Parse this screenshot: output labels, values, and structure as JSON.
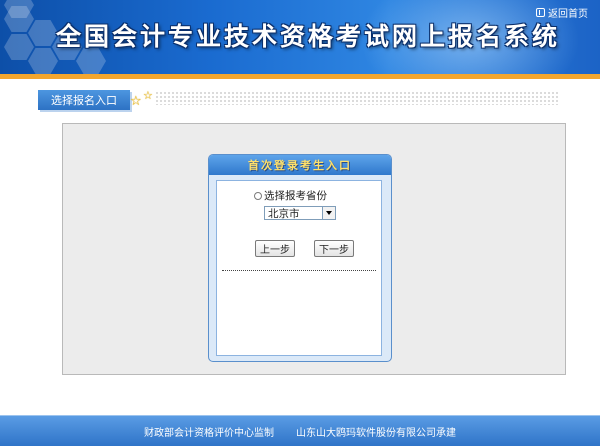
{
  "header": {
    "title": "全国会计专业技术资格考试网上报名系统",
    "back_home": "返回首页",
    "back_home_icon": "home-icon"
  },
  "nav": {
    "entry_tab": "选择报名入口",
    "star_icon": "star-icon"
  },
  "form": {
    "title": "首次登录考生入口",
    "radio_label": "选择报考省份",
    "province_selected": "北京市",
    "prev_button": "上一步",
    "next_button": "下一步"
  },
  "footer": {
    "supervisor": "财政部会计资格评价中心监制",
    "developer": "山东山大鸥玛软件股份有限公司承建"
  },
  "colors": {
    "header_blue": "#1a6bd0",
    "accent_orange": "#f3a62e",
    "panel_gray": "#ececec",
    "card_blue": "#dbe9f8",
    "title_yellow": "#ffe06a"
  }
}
